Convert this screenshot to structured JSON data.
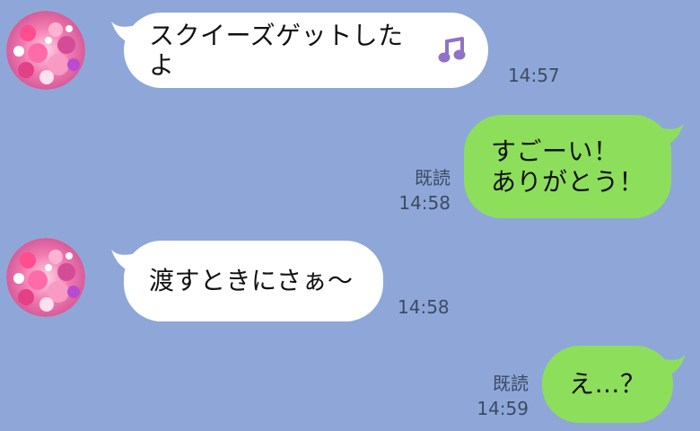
{
  "chat": {
    "messages": [
      {
        "sender": "other",
        "text": "スクイーズゲットしたよ",
        "time": "14:57",
        "icon": "music-note-icon"
      },
      {
        "sender": "self",
        "text_line1": "すごーい！",
        "text_line2": "ありがとう！",
        "read": "既読",
        "time": "14:58"
      },
      {
        "sender": "other",
        "text": "渡すときにさぁ～",
        "time": "14:58"
      },
      {
        "sender": "self",
        "text": "え…？",
        "read": "既読",
        "time": "14:59"
      }
    ]
  },
  "colors": {
    "background": "#8ea7d8",
    "incoming_bubble": "#ffffff",
    "outgoing_bubble": "#8ddf5b",
    "meta_text": "#3c4b62",
    "music_icon": "#8f73c7"
  }
}
